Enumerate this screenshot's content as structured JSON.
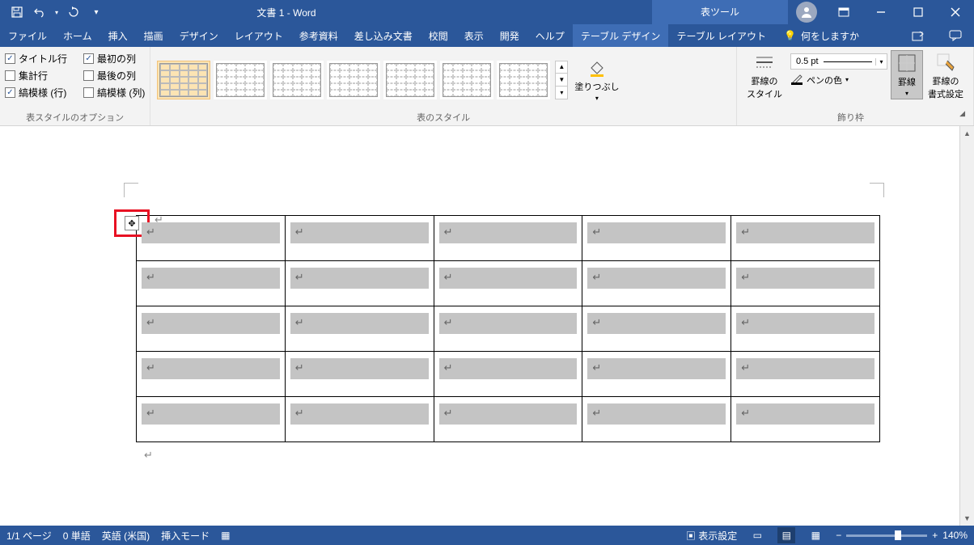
{
  "title": "文書 1 - Word",
  "context_tool": "表ツール",
  "tabs": [
    "ファイル",
    "ホーム",
    "挿入",
    "描画",
    "デザイン",
    "レイアウト",
    "参考資料",
    "差し込み文書",
    "校閲",
    "表示",
    "開発",
    "ヘルプ",
    "テーブル デザイン",
    "テーブル レイアウト"
  ],
  "active_tab": "テーブル デザイン",
  "tell_me": "何をしますか",
  "style_options": {
    "title_row": {
      "label": "タイトル行",
      "checked": true
    },
    "total_row": {
      "label": "集計行",
      "checked": false
    },
    "banded_rows": {
      "label": "縞模様 (行)",
      "checked": true
    },
    "first_col": {
      "label": "最初の列",
      "checked": true
    },
    "last_col": {
      "label": "最後の列",
      "checked": false
    },
    "banded_cols": {
      "label": "縞模様 (列)",
      "checked": false
    }
  },
  "group_labels": {
    "opts": "表スタイルのオプション",
    "styles": "表のスタイル",
    "borders": "飾り枠"
  },
  "buttons": {
    "shading": "塗りつぶし",
    "border_styles": "罫線の\nスタイル",
    "border_width": "0.5 pt",
    "pen_color": "ペンの色",
    "borders": "罫線",
    "border_painter": "罫線の\n書式設定"
  },
  "status": {
    "page": "1/1 ページ",
    "words": "0 単語",
    "lang": "英語 (米国)",
    "mode": "挿入モード",
    "display": "表示設定",
    "zoom": "140%"
  },
  "table": {
    "rows": 5,
    "cols": 5
  }
}
